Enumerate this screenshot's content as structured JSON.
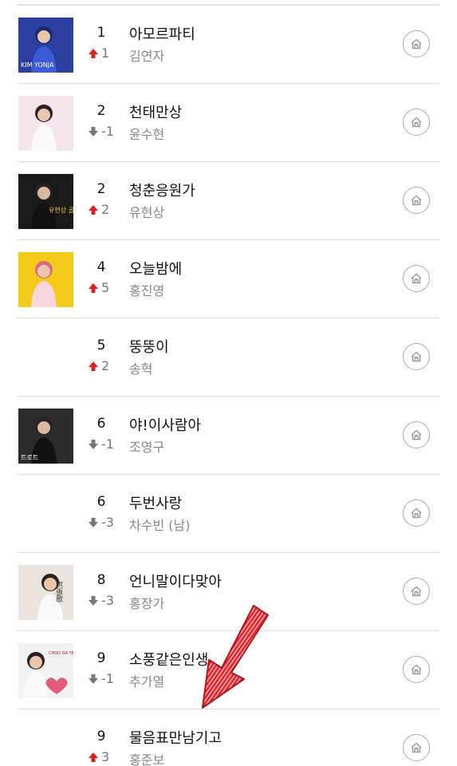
{
  "chart_rows": [
    {
      "rank": "1",
      "direction": "up",
      "change": "1",
      "title": "아모르파티",
      "artist": "김연자",
      "has_thumb": true,
      "thumb_bg": "#2a3fa0",
      "thumb_text": "KIM YONJA"
    },
    {
      "rank": "2",
      "direction": "down",
      "change": "-1",
      "title": "천태만상",
      "artist": "윤수현",
      "has_thumb": true,
      "thumb_bg": "#f4e6ec",
      "thumb_text": ""
    },
    {
      "rank": "2",
      "direction": "up",
      "change": "2",
      "title": "청춘응원가",
      "artist": "유현상",
      "has_thumb": true,
      "thumb_bg": "#1a1a1a",
      "thumb_text": "유현상 골든"
    },
    {
      "rank": "4",
      "direction": "up",
      "change": "5",
      "title": "오늘밤에",
      "artist": "홍진영",
      "has_thumb": true,
      "thumb_bg": "#f3c91a",
      "thumb_text": ""
    },
    {
      "rank": "5",
      "direction": "up",
      "change": "2",
      "title": "뚱뚱이",
      "artist": "송혁",
      "has_thumb": false,
      "thumb_bg": "",
      "thumb_text": ""
    },
    {
      "rank": "6",
      "direction": "down",
      "change": "-1",
      "title": "야!이사람아",
      "artist": "조영구",
      "has_thumb": true,
      "thumb_bg": "#2b2b2b",
      "thumb_text": "트로트"
    },
    {
      "rank": "6",
      "direction": "down",
      "change": "-3",
      "title": "두번사랑",
      "artist": "차수빈 (남)",
      "has_thumb": false,
      "thumb_bg": "",
      "thumb_text": ""
    },
    {
      "rank": "8",
      "direction": "down",
      "change": "-3",
      "title": "언니말이다맞아",
      "artist": "홍장가",
      "has_thumb": true,
      "thumb_bg": "#e9e4df",
      "thumb_text": "洪張歌"
    },
    {
      "rank": "9",
      "direction": "down",
      "change": "-1",
      "title": "소풍같은인생",
      "artist": "추가열",
      "has_thumb": true,
      "thumb_bg": "#f2f2f2",
      "thumb_text": "CHOO GA YEOUL"
    },
    {
      "rank": "9",
      "direction": "up",
      "change": "3",
      "title": "물음표만남기고",
      "artist": "홍준보",
      "has_thumb": false,
      "thumb_bg": "",
      "thumb_text": ""
    }
  ],
  "colors": {
    "up_arrow": "#e02020",
    "down_arrow": "#777777",
    "annotation_arrow": "#e8222a"
  },
  "icons": {
    "row_action": "home-icon",
    "up": "up-arrow-icon",
    "down": "down-arrow-icon"
  }
}
